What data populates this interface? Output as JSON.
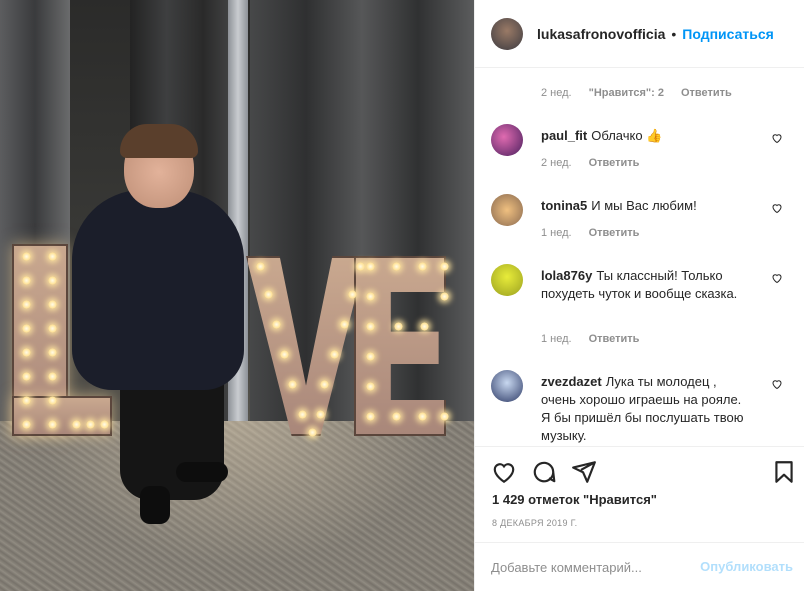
{
  "post": {
    "photo_letters": "LVE"
  },
  "header": {
    "username": "lukasafronovofficia",
    "separator": "•",
    "follow_label": "Подписаться"
  },
  "comments": {
    "top_meta": {
      "time": "2 нед.",
      "likes": "\"Нравится\": 2",
      "reply": "Ответить"
    },
    "items": [
      {
        "user": "paul_fit",
        "text": "Облачко 👍",
        "time": "2 нед.",
        "reply": "Ответить"
      },
      {
        "user": "tonina5",
        "text": "И мы Вас любим!",
        "time": "1 нед.",
        "reply": "Ответить"
      },
      {
        "user": "lola876y",
        "text": "Ты классный! Только похудеть чуток и вообще сказка.",
        "time": "1 нед.",
        "reply": "Ответить"
      },
      {
        "user": "zvezdazet",
        "text": "Лука ты молодец , очень хорошо играешь на рояле. Я бы пришёл бы послушать твою музыку.",
        "time": "",
        "reply": ""
      }
    ]
  },
  "actions": {
    "likes_text": "1 429 отметок \"Нравится\"",
    "date_text": "8 ДЕКАБРЯ 2019 Г."
  },
  "add_comment": {
    "placeholder": "Добавьте комментарий...",
    "publish_label": "Опубликовать"
  },
  "icons": [
    "heart-icon",
    "comment-icon",
    "share-icon",
    "bookmark-icon",
    "small-heart-icon"
  ],
  "colors": {
    "link": "#0095f6",
    "muted": "#8e8e8e",
    "publish_disabled": "#b2dffc"
  }
}
